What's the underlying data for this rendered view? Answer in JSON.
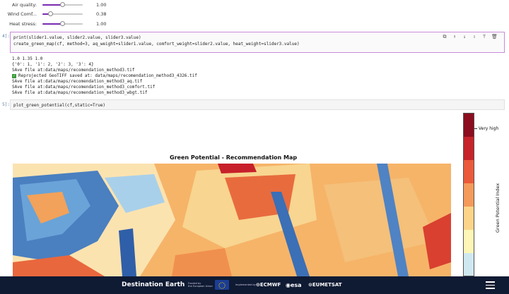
{
  "sliders": [
    {
      "label": "Air quality:",
      "value": "1.00",
      "fraction": 0.5
    },
    {
      "label": "Wind Comf...",
      "value": "0.38",
      "fraction": 0.19
    },
    {
      "label": "Heat stress:",
      "value": "1.00",
      "fraction": 0.5
    }
  ],
  "cell4": {
    "prompt": "4]:",
    "lines": [
      "print(slider1.value, slider2.value, slider3.value)",
      "create_green_map(cf, method=3, aq_weight=slider1.value, comfort_weight=slider2.value, heat_weight=slider3.value)"
    ]
  },
  "output4": {
    "lines": [
      "1.0 1.35 1.0",
      "{'0': 1, '1': 2, '2': 3, '3': 4}",
      "SAve file at:data/maps/recomendation_method3.tif",
      "Reprojected GeoTIFF saved at: data/maps/recomendation_method3_4326.tif",
      "SAve file at:data/maps/recomendation_method3_aq.tif",
      "SAve file at:data/maps/recomendation_method3_comfort.tif",
      "SAve file at:data/maps/recomendation_method3_wbgt.tif"
    ]
  },
  "cell5": {
    "prompt": "5]:",
    "code": "plot_green_potential(cf,static=True)"
  },
  "toolbar_icons": [
    "copy-icon",
    "arrow-up-icon",
    "arrow-down-icon",
    "save-icon",
    "format-icon",
    "trash-icon"
  ],
  "figure": {
    "title": "Green Potential - Recommendation Map",
    "colorbar_top_label": "Very high",
    "colorbar_axis_label": "Green Potential Index",
    "colorbar_colors": [
      "#8b0d1e",
      "#c6232a",
      "#ea5a3b",
      "#f49a5b",
      "#fcd489",
      "#fdf6b6",
      "#cfe8f0"
    ]
  },
  "footer": {
    "brand": "Destination Earth",
    "funded_line1": "Funded by",
    "funded_line2": "the European Union",
    "implemented_by": "Implemented by",
    "ecmwf": "ECMWF",
    "esa": "esa",
    "eumetsat": "EUMETSAT"
  }
}
